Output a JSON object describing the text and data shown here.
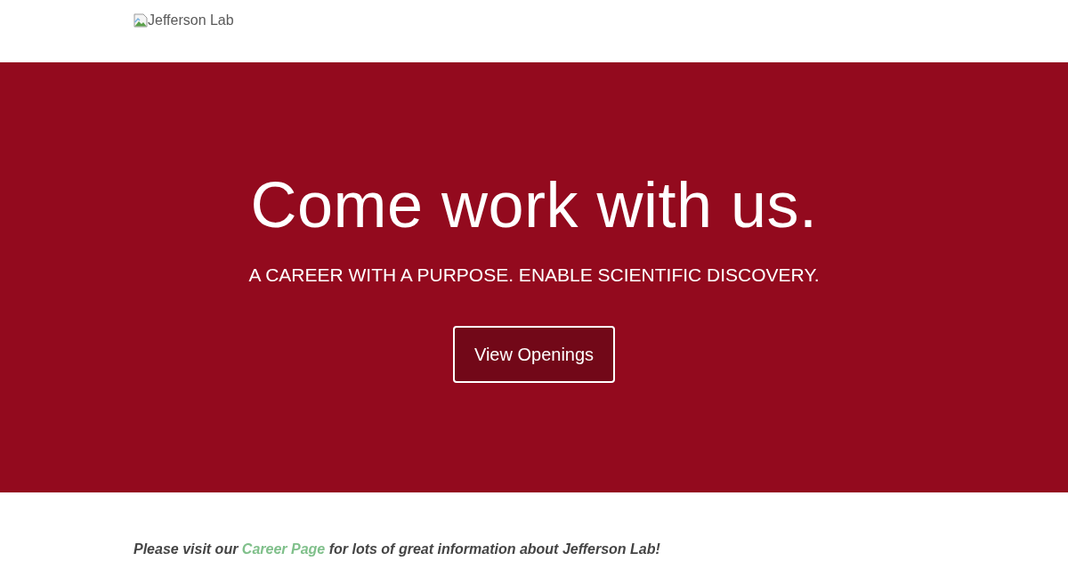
{
  "header": {
    "logo_alt": "Jefferson Lab"
  },
  "hero": {
    "title": "Come work with us.",
    "subtitle": "A CAREER WITH A PURPOSE. ENABLE SCIENTIFIC DISCOVERY.",
    "button": "View Openings"
  },
  "intro": {
    "before": "Please visit our ",
    "link": "Career Page",
    "after": " for lots of great information about Jefferson Lab!"
  }
}
